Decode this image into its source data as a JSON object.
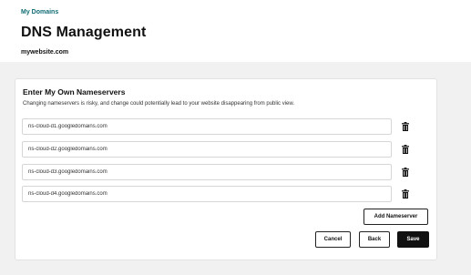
{
  "header": {
    "breadcrumb": "My Domains",
    "title": "DNS Management",
    "domain": "mywebsite.com"
  },
  "card": {
    "title": "Enter My Own Nameservers",
    "description": "Changing nameservers is risky, and change could potentially lead to your website disappearing from public view.",
    "nameservers": [
      "ns-cloud-d1.googledomains.com",
      "ns-cloud-d2.googledomains.com",
      "ns-cloud-d3.googledomains.com",
      "ns-cloud-d4.googledomains.com"
    ],
    "delete_icon": "trash-icon",
    "add_nameserver_label": "Add Nameserver",
    "cancel_label": "Cancel",
    "back_label": "Back",
    "save_label": "Save"
  },
  "colors": {
    "breadcrumb": "#0f6b72",
    "background": "#f1f1f1",
    "primary_button": "#111111"
  }
}
